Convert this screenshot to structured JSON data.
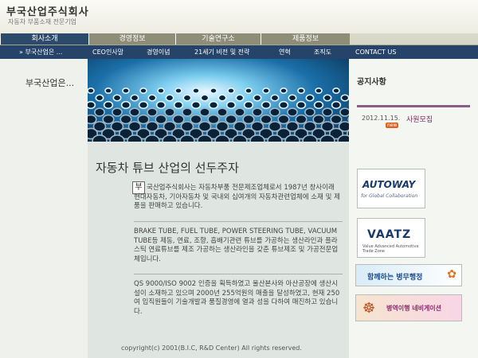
{
  "header": {
    "company_name": "부국산업주식회사",
    "tagline": "자동차 부품소재 전문기업"
  },
  "main_nav": [
    {
      "label": "회사소개",
      "active": true
    },
    {
      "label": "경영정보",
      "active": false
    },
    {
      "label": "기술연구소",
      "active": false
    },
    {
      "label": "제품정보",
      "active": false
    }
  ],
  "sub_nav": {
    "current": "» 부국산업은 ...",
    "items": [
      "CEO인사말",
      "경영이념",
      "21세기 비전 및 전략",
      "연혁",
      "조직도",
      "CONTACT US"
    ]
  },
  "breadcrumb": "부국산업은...",
  "content": {
    "headline": "자동차 튜브 산업의 선두주자",
    "dropcap": "부",
    "para1": "국산업주식회사는 자동차부품 전문제조업체로서 1987년 창사이래 현대자동차, 기아자동차 및 국내외 십여개의 자동차관련업체에 소재 및 제품을 판매하고 있습니다.",
    "para2": "BRAKE TUBE, FUEL TUBE, POWER STEERING TUBE, VACUUM TUBE등 제동, 연료, 조향, 흡배기관련 튜브를 가공하는 생산라인과 플라스틱 연료튜브를 제조 가공하는 생산라인을 갖춘 튜브제조 및 가공전문업체입니다.",
    "para3": "QS 9000/ISO 9002 인증을 획득하였고 울산본사와 아산공장에 생산시설이 소재하고 있으며 2000년 255억원의 매출을 달성하였고, 현재 250여 임직원들이 기술개발과 품질경영에 열과 성을 다하여 매진하고 있습니다.",
    "copyright": "copyright(c) 2001(B.I.C, R&D Center) All rights reserved."
  },
  "notice": {
    "title": "공지사항",
    "items": [
      {
        "date": "2012.11.15.",
        "title": "사원모집",
        "badge": "new"
      }
    ]
  },
  "banners": {
    "autoway": {
      "title": "AUTOWAY",
      "subtitle": "for Global Collaboration"
    },
    "vaatz": {
      "title": "VAATZ",
      "subtitle": "Value Advanced Automotive Trade Zone"
    },
    "military": {
      "title": "함께하는 병무행정"
    },
    "navigation": {
      "title": "병역이행 네비게이션"
    }
  },
  "icons": [
    "notice-bullet-icon",
    "military-emblem-icon",
    "ship-wheel-icon"
  ],
  "colors": {
    "nav_active": "#2c4a6a",
    "nav_tab": "#8d8d78",
    "subnav": "#26446a",
    "notice_link": "#7a2a5a"
  }
}
